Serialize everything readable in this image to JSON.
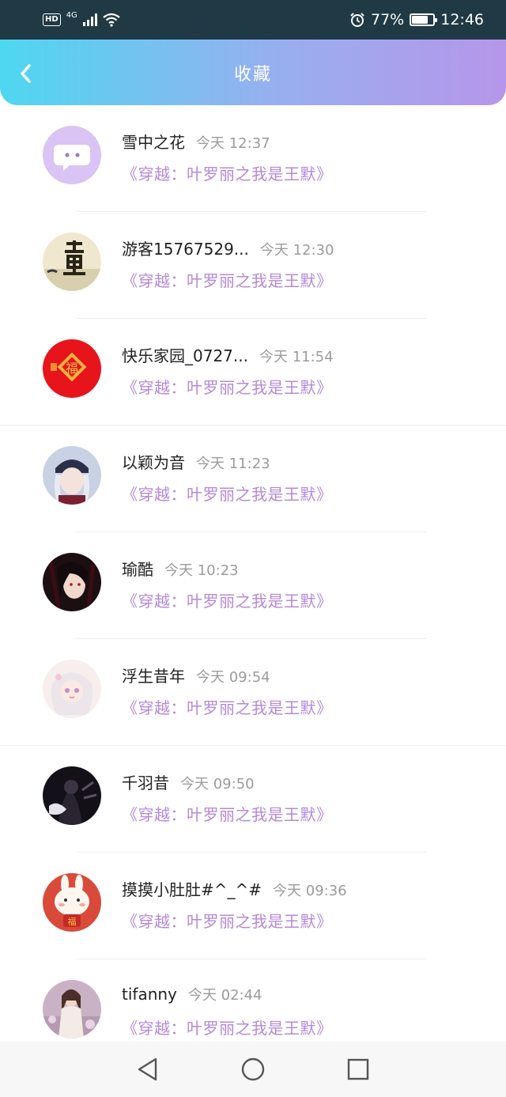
{
  "status_bar": {
    "hd": "HD",
    "network": "4G",
    "battery_percent": "77%",
    "battery_level": 0.77,
    "time": "12:46",
    "icons": [
      "signal-icon",
      "wifi-icon",
      "alarm-icon",
      "battery-icon"
    ]
  },
  "header": {
    "title": "收藏",
    "back_icon": "chevron-left-icon",
    "gradient": [
      "#4ed7f0",
      "#b696ea"
    ]
  },
  "items": [
    {
      "name": "雪中之花",
      "time": "今天 12:37",
      "title": "《穿越：叶罗丽之我是王默》",
      "avatar": "chat-bubble-avatar"
    },
    {
      "name": "游客15767529...",
      "time": "今天 12:30",
      "title": "《穿越：叶罗丽之我是王默》",
      "avatar": "calligraphy-avatar"
    },
    {
      "name": "快乐家园_0727...",
      "time": "今天 11:54",
      "title": "《穿越：叶罗丽之我是王默》",
      "avatar": "fu-character-avatar"
    },
    {
      "name": "以颖为音",
      "time": "今天 11:23",
      "title": "《穿越：叶罗丽之我是王默》",
      "avatar": "anime-girl-avatar"
    },
    {
      "name": "瑜酷",
      "time": "今天 10:23",
      "title": "《穿越：叶罗丽之我是王默》",
      "avatar": "dark-hair-avatar"
    },
    {
      "name": "浮生昔年",
      "time": "今天 09:54",
      "title": "《穿越：叶罗丽之我是王默》",
      "avatar": "pastel-girl-avatar"
    },
    {
      "name": "千羽昔",
      "time": "今天 09:50",
      "title": "《穿越：叶罗丽之我是王默》",
      "avatar": "dark-figure-avatar"
    },
    {
      "name": "摸摸小肚肚#^_^#",
      "time": "今天 09:36",
      "title": "《穿越：叶罗丽之我是王默》",
      "avatar": "bunny-avatar"
    },
    {
      "name": "tifanny",
      "time": "今天 02:44",
      "title": "《穿越：叶罗丽之我是王默》",
      "avatar": "photo-avatar"
    }
  ],
  "colors": {
    "accent_title": "#b489d8",
    "time_text": "#9b9b9b"
  },
  "nav_bar": [
    "back-triangle-icon",
    "home-circle-icon",
    "recents-square-icon"
  ]
}
